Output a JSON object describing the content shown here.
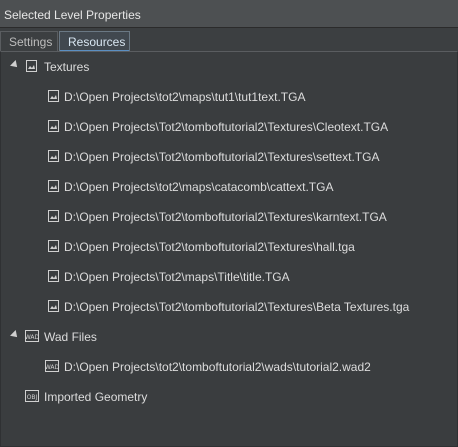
{
  "window": {
    "title": "Selected Level Properties"
  },
  "tabs": [
    {
      "label": "Settings",
      "active": false
    },
    {
      "label": "Resources",
      "active": true
    }
  ],
  "tree": {
    "textures": {
      "label": "Textures",
      "expanded": true,
      "items": [
        "D:\\Open Projects\\tot2\\maps\\tut1\\tut1text.TGA",
        "D:\\Open Projects\\Tot2\\tomboftutorial2\\Textures\\Cleotext.TGA",
        "D:\\Open Projects\\Tot2\\tomboftutorial2\\Textures\\settext.TGA",
        "D:\\Open Projects\\tot2\\maps\\catacomb\\cattext.TGA",
        "D:\\Open Projects\\Tot2\\tomboftutorial2\\Textures\\karntext.TGA",
        "D:\\Open Projects\\Tot2\\tomboftutorial2\\Textures\\hall.tga",
        "D:\\Open Projects\\Tot2\\maps\\Title\\title.TGA",
        "D:\\Open Projects\\Tot2\\tomboftutorial2\\Textures\\Beta Textures.tga"
      ]
    },
    "wad_files": {
      "label": "Wad Files",
      "expanded": true,
      "items": [
        "D:\\Open Projects\\tot2\\tomboftutorial2\\wads\\tutorial2.wad2"
      ]
    },
    "imported_geometry": {
      "label": "Imported Geometry",
      "expanded": false
    }
  },
  "icons": {
    "texture": "texture-file-icon",
    "wad": "wad-file-icon",
    "geometry": "obj-file-icon",
    "expand": "expand-arrow-icon"
  },
  "colors": {
    "background": "#3c3f41",
    "active_tab_accent": "#5b8fc2"
  }
}
